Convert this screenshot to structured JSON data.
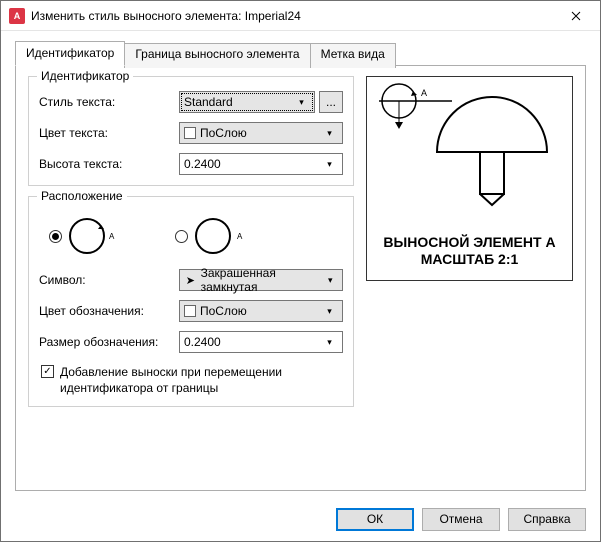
{
  "window": {
    "title": "Изменить стиль выносного элемента: Imperial24"
  },
  "tabs": {
    "identifier": "Идентификатор",
    "boundary": "Граница выносного элемента",
    "viewLabel": "Метка вида"
  },
  "group_identifier": {
    "legend": "Идентификатор",
    "textStyle_label": "Стиль текста:",
    "textStyle_value": "Standard",
    "ellipsis": "...",
    "textColor_label": "Цвет текста:",
    "textColor_value": "ПоСлою",
    "textHeight_label": "Высота текста:",
    "textHeight_value": "0.2400"
  },
  "group_placement": {
    "legend": "Расположение",
    "marker_A": "A",
    "symbol_label": "Символ:",
    "symbol_value": "Закрашенная замкнутая",
    "markColor_label": "Цвет обозначения:",
    "markColor_value": "ПоСлою",
    "markSize_label": "Размер обозначения:",
    "markSize_value": "0.2400",
    "checkbox_label": "Добавление выноски при перемещении идентификатора от границы"
  },
  "preview": {
    "line1": "ВЫНОСНОЙ ЭЛЕМЕНТ A",
    "line2": "МАСШТАБ 2:1"
  },
  "footer": {
    "ok": "ОК",
    "cancel": "Отмена",
    "help": "Справка"
  }
}
